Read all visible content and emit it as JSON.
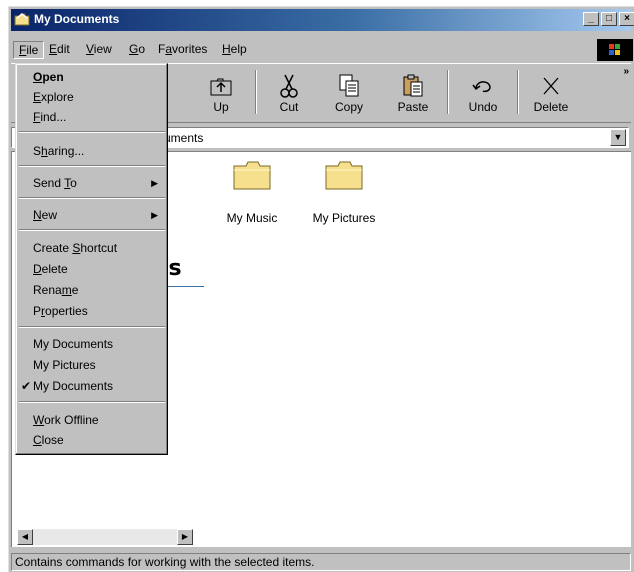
{
  "window": {
    "title": "My Documents",
    "controls": [
      "_",
      "□",
      "×"
    ]
  },
  "menubar": {
    "items": [
      {
        "pre": "",
        "key": "F",
        "post": "ile"
      },
      {
        "pre": "",
        "key": "E",
        "post": "dit"
      },
      {
        "pre": "",
        "key": "V",
        "post": "iew"
      },
      {
        "pre": "",
        "key": "G",
        "post": "o"
      },
      {
        "pre": "F",
        "key": "a",
        "post": "vorites"
      },
      {
        "pre": "",
        "key": "H",
        "post": "elp"
      }
    ]
  },
  "toolbar": {
    "up_label": "Up",
    "cut_label": "Cut",
    "copy_label": "Copy",
    "paste_label": "Paste",
    "undo_label": "Undo",
    "delete_label": "Delete",
    "more_glyph": "»"
  },
  "address": {
    "visible_text": "uments"
  },
  "content": {
    "folders": [
      {
        "label": "My Music"
      },
      {
        "label": "My Pictures"
      }
    ],
    "heading_fragment": "ts"
  },
  "file_menu": {
    "open": {
      "pre": "",
      "key": "O",
      "post": "pen"
    },
    "explore": {
      "pre": "",
      "key": "E",
      "post": "xplore"
    },
    "find": {
      "pre": "",
      "key": "F",
      "post": "ind..."
    },
    "sharing": {
      "pre": "S",
      "key": "h",
      "post": "aring..."
    },
    "send_to": {
      "pre": "Send ",
      "key": "T",
      "post": "o"
    },
    "new": {
      "pre": "",
      "key": "N",
      "post": "ew"
    },
    "create_shortcut": {
      "pre": "Create ",
      "key": "S",
      "post": "hortcut"
    },
    "delete": {
      "pre": "",
      "key": "D",
      "post": "elete"
    },
    "rename": {
      "pre": "Rena",
      "key": "m",
      "post": "e"
    },
    "properties": {
      "pre": "P",
      "key": "r",
      "post": "operties"
    },
    "history": [
      "My Documents",
      "My Pictures",
      "My Documents"
    ],
    "checked_history_index": 2,
    "work_offline": {
      "pre": "",
      "key": "W",
      "post": "ork Offline"
    },
    "close": {
      "pre": "",
      "key": "C",
      "post": "lose"
    }
  },
  "status": {
    "text": "Contains commands for working with the selected items."
  },
  "colors": {
    "title_start": "#0a246a",
    "title_end": "#a6caf0",
    "face": "#c0c0c0",
    "folder": "#f6e08e"
  }
}
